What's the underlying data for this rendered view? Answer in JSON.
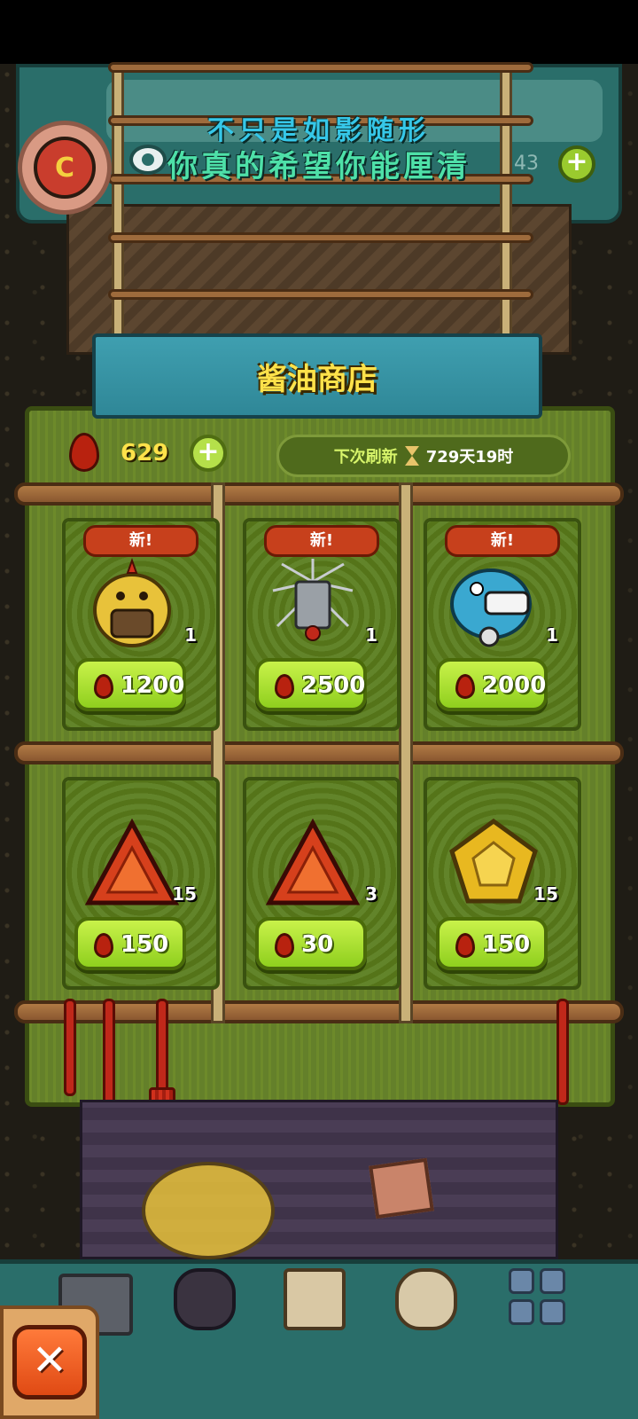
{
  "banner": {
    "line1": "不只是如影随形",
    "line2": "你真的希望你能厘清"
  },
  "top": {
    "badge_letter": "C",
    "count_partial": "43",
    "plus": "+"
  },
  "shop": {
    "title": "酱油商店",
    "currency_value": "629",
    "currency_plus": "+",
    "refresh_label": "下次刷新",
    "refresh_time": "729天19时",
    "items": [
      {
        "tag": "新!",
        "count": "1",
        "price": "1200",
        "icon": "yellow-chick-monster-icon"
      },
      {
        "tag": "新!",
        "count": "1",
        "price": "2500",
        "icon": "spiky-ghost-monster-icon"
      },
      {
        "tag": "新!",
        "count": "1",
        "price": "2000",
        "icon": "blue-fish-monster-icon"
      },
      {
        "tag": "",
        "count": "15",
        "price": "150",
        "icon": "red-triangle-gem-icon"
      },
      {
        "tag": "",
        "count": "3",
        "price": "30",
        "icon": "red-triangle-gem-icon"
      },
      {
        "tag": "",
        "count": "15",
        "price": "150",
        "icon": "gold-pentagon-gem-icon"
      }
    ]
  },
  "close_label": "✕",
  "colors": {
    "accent_yellow": "#ffe24a",
    "button_green": "#9acb2e",
    "tag_red": "#c7401c",
    "teal": "#2a6e6a"
  }
}
